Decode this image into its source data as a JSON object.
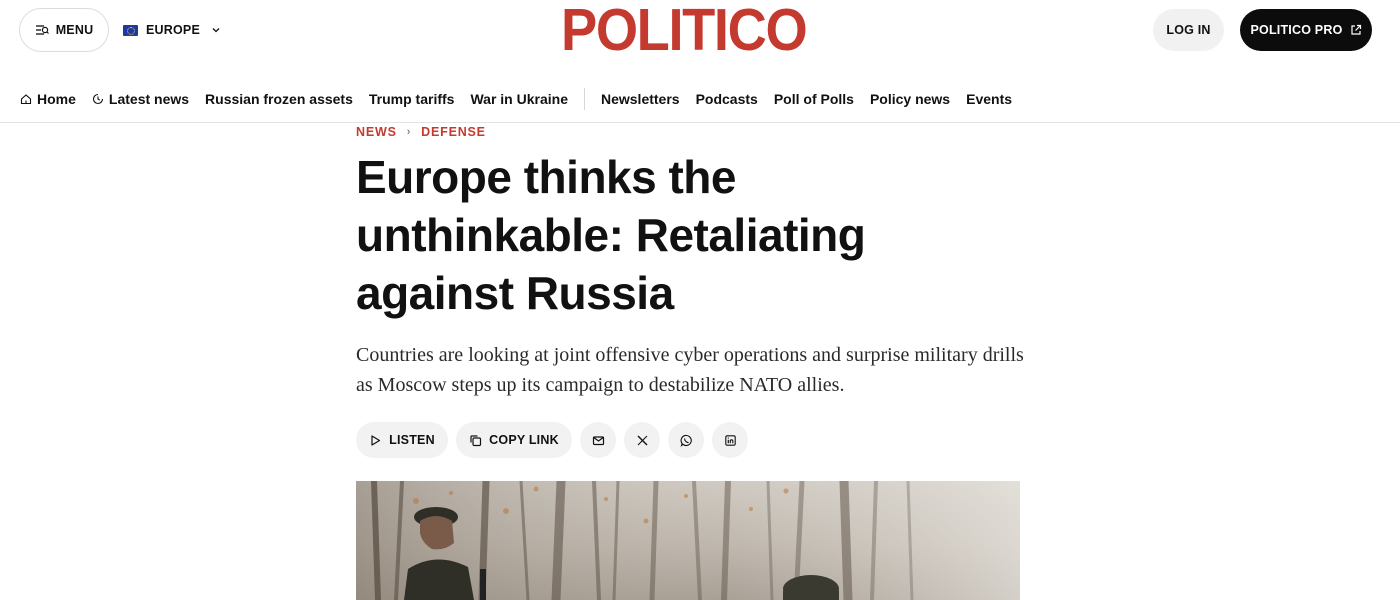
{
  "header": {
    "menu_label": "MENU",
    "edition_label": "EUROPE",
    "logo_text": "POLITICO",
    "login_label": "LOG IN",
    "pro_label": "POLITICO PRO",
    "brand_color": "#c43a2f"
  },
  "nav": {
    "items": [
      {
        "label": "Home",
        "icon": "home-icon"
      },
      {
        "label": "Latest news",
        "icon": "clock-icon"
      },
      {
        "label": "Russian frozen assets"
      },
      {
        "label": "Trump tariffs"
      },
      {
        "label": "War in Ukraine"
      }
    ],
    "secondary": [
      {
        "label": "Newsletters"
      },
      {
        "label": "Podcasts"
      },
      {
        "label": "Poll of Polls"
      },
      {
        "label": "Policy news"
      },
      {
        "label": "Events"
      }
    ]
  },
  "article": {
    "breadcrumb": [
      "NEWS",
      "DEFENSE"
    ],
    "headline": "Europe thinks the unthinkable: Retaliating against Russia",
    "dek": "Countries are looking at joint offensive cyber operations and surprise military drills as Moscow steps up its campaign to destabilize NATO allies.",
    "tools": {
      "listen_label": "LISTEN",
      "copy_label": "COPY LINK",
      "share_icons": [
        "mail-icon",
        "x-icon",
        "whatsapp-icon",
        "linkedin-icon"
      ]
    }
  }
}
